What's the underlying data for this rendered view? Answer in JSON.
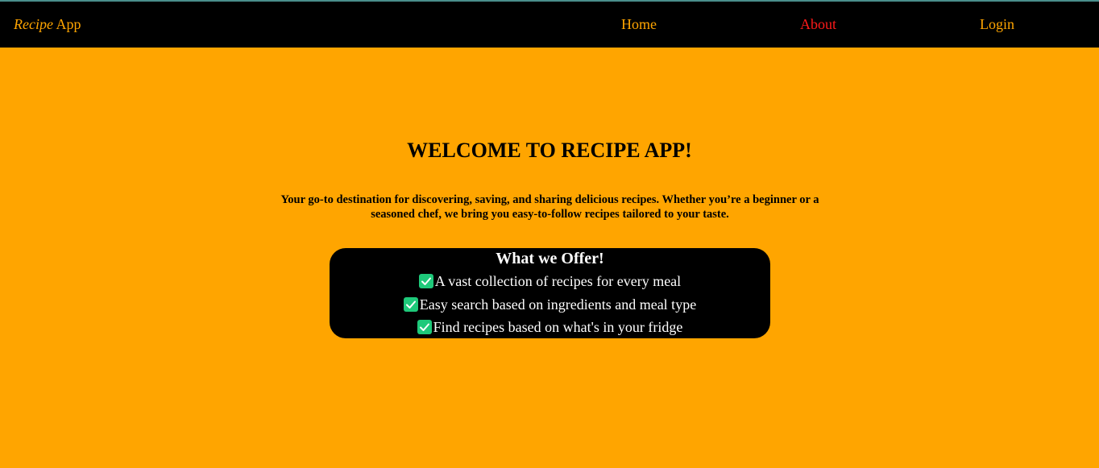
{
  "nav": {
    "brand_italic": "Recipe",
    "brand_rest": " App",
    "links": [
      {
        "label": "Home",
        "active": false
      },
      {
        "label": "About",
        "active": true
      },
      {
        "label": "Login",
        "active": false
      }
    ]
  },
  "hero": {
    "title": "WELCOME TO RECIPE APP!",
    "description": "Your go-to destination for discovering, saving, and sharing delicious recipes. Whether you’re a beginner or a seasoned chef, we bring you easy-to-follow recipes tailored to your taste."
  },
  "offer": {
    "title": "What we Offer!",
    "icon": "check-mark-icon",
    "items": [
      "A vast collection of recipes for every meal",
      "Easy search based on ingredients and meal type",
      "Find recipes based on what's in your fridge"
    ]
  },
  "colors": {
    "background": "#ffa500",
    "navbar": "#000000",
    "nav_link": "#ffa500",
    "nav_link_active": "#ff1a1a",
    "check": "#1ec97a"
  }
}
